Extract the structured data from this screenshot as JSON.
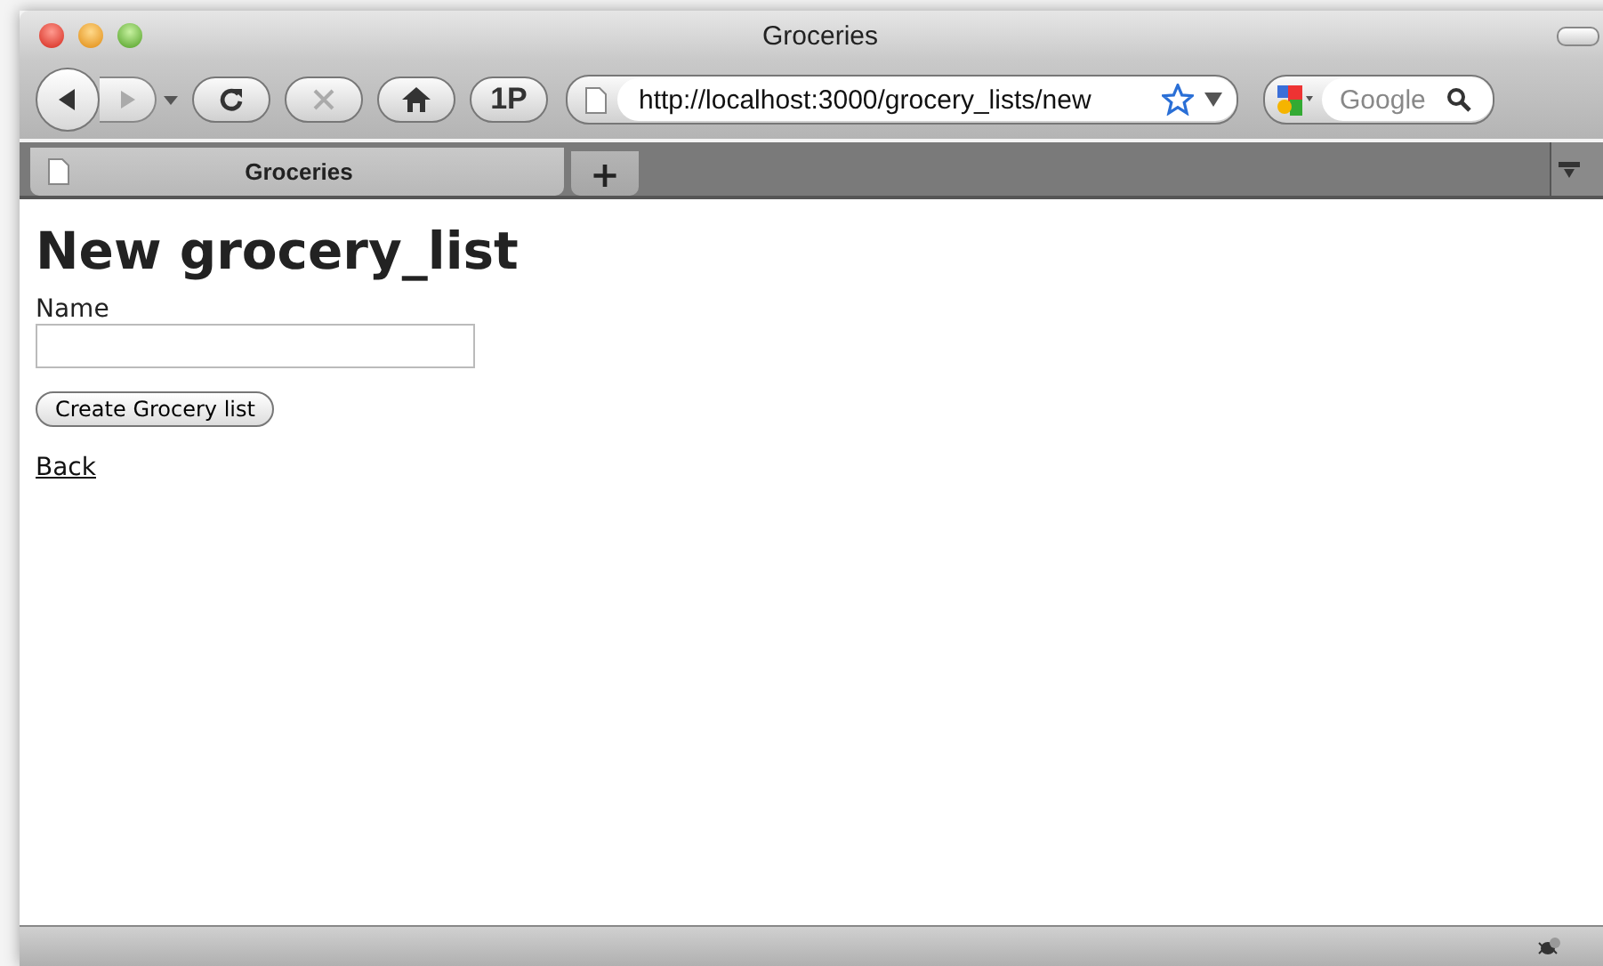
{
  "window": {
    "title": "Groceries"
  },
  "toolbar": {
    "profile_button": "1P",
    "url": "http://localhost:3000/grocery_lists/new",
    "search": {
      "placeholder": "Google"
    }
  },
  "tabs": [
    {
      "label": "Groceries",
      "selected": true
    }
  ],
  "new_tab_button": "+",
  "page": {
    "heading": "New grocery_list",
    "field_label": "Name",
    "submit_button": "Create Grocery list",
    "back_link": "Back"
  }
}
